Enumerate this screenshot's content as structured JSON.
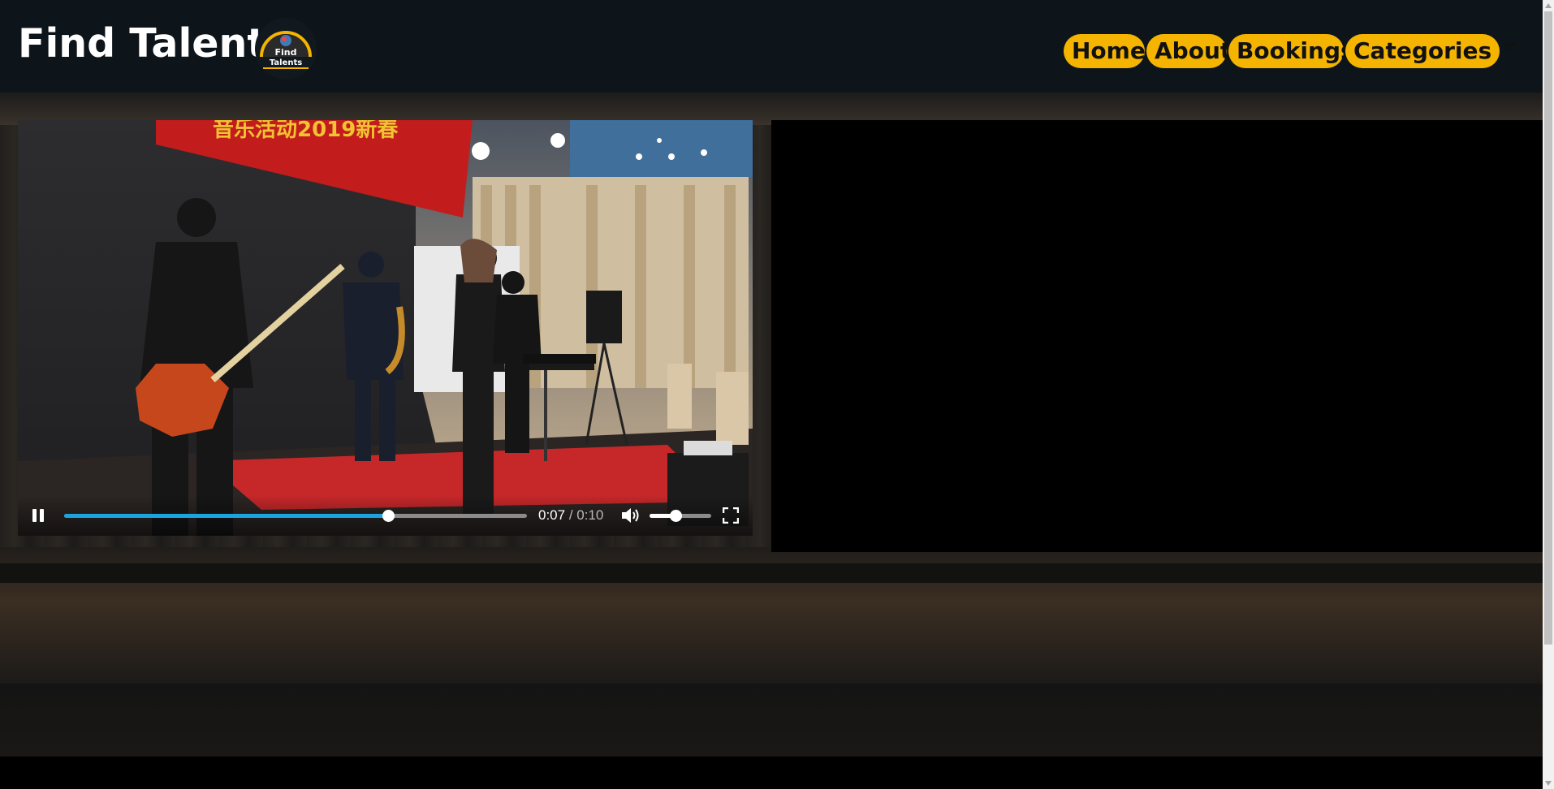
{
  "header": {
    "brand": "Find Talents",
    "logo_text_line1": "Find",
    "logo_text_line2": "Talents"
  },
  "nav": {
    "items": [
      {
        "label": "Home"
      },
      {
        "label": "About"
      },
      {
        "label": "Bookings"
      },
      {
        "label": "Categories"
      }
    ]
  },
  "player": {
    "current_time": "0:07",
    "separator": " / ",
    "duration": "0:10",
    "progress_fraction": 0.7,
    "volume_fraction": 0.42,
    "state": "playing",
    "banner_text": "音乐活动2019新春"
  },
  "colors": {
    "accent": "#f4b400",
    "progress": "#1aa3de",
    "header_bg": "#0e151a"
  },
  "icons": [
    "pause-icon",
    "volume-icon",
    "fullscreen-icon",
    "chevron-down-icon"
  ]
}
